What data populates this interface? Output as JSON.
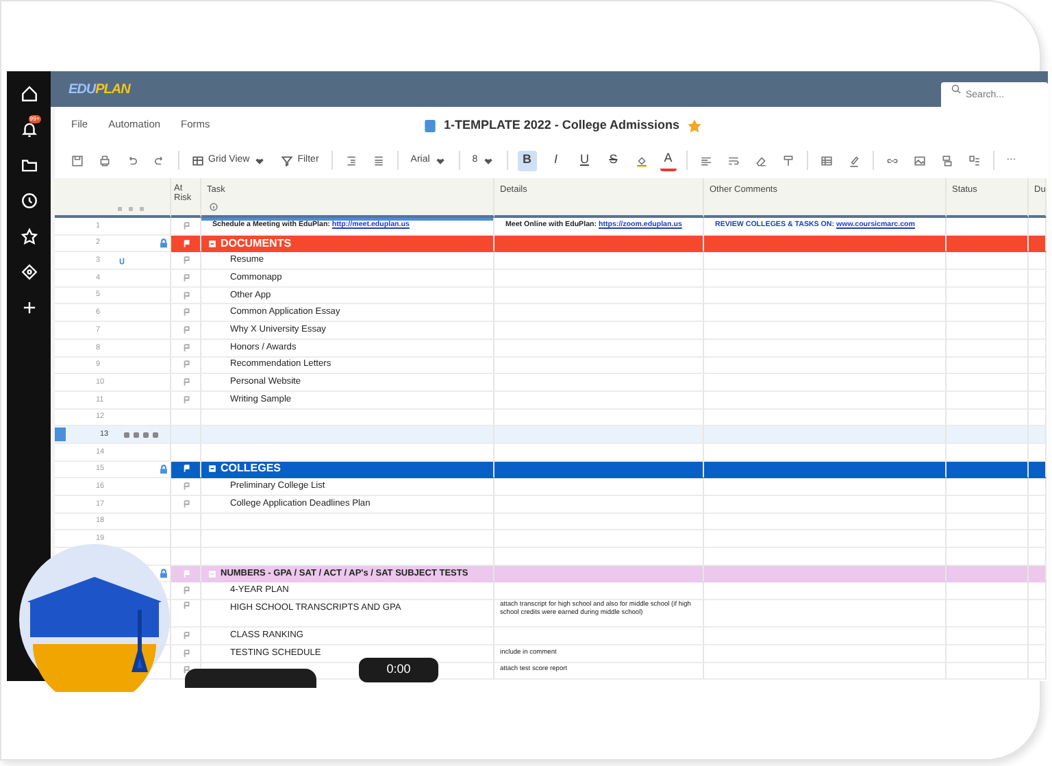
{
  "sidebar": {
    "notification_badge": "99+"
  },
  "header": {
    "logo": [
      "EDU",
      "PLAN"
    ],
    "search": {
      "placeholder": "Search..."
    }
  },
  "menu": [
    "File",
    "Automation",
    "Forms"
  ],
  "sheet_title": {
    "text": "1-TEMPLATE 2022 - College Admissions",
    "favorite": true
  },
  "toolbar": {
    "view": "Grid View",
    "filter": "Filter",
    "font": "Arial",
    "size": "8",
    "format": [
      {
        "label": "B",
        "selected": true
      },
      {
        "label": "I",
        "selected": false
      },
      {
        "label": "U",
        "selected": false
      },
      {
        "label": "S",
        "selected": false
      }
    ],
    "text_color": "A",
    "more": "···"
  },
  "columns": [
    {
      "label": "At Risk"
    },
    {
      "label": "Task"
    },
    {
      "label": "Details"
    },
    {
      "label": "Other Comments"
    },
    {
      "label": "Status"
    },
    {
      "label": "Du"
    }
  ],
  "rows": [
    {
      "num": "1",
      "kind": "note",
      "task": "Schedule a Meeting with EduPlan: ",
      "task_link": "http://meet.eduplan.us",
      "details": "Meet Online with EduPlan: ",
      "details_link": "https://zoom.eduplan.us",
      "comments": "REVIEW COLLEGES & TASKS ON: ",
      "comments_link": "www.coursicmarc.com",
      "selected": false,
      "locked": false,
      "attachment": false
    },
    {
      "num": "2",
      "kind": "section",
      "task": "DOCUMENTS",
      "color": "#f4492d",
      "selected": false,
      "locked": true,
      "attachment": false
    },
    {
      "num": "3",
      "kind": "task",
      "task": "Resume",
      "selected": false,
      "locked": false,
      "attachment": true
    },
    {
      "num": "4",
      "kind": "task",
      "task": "Commonapp",
      "selected": false,
      "locked": false,
      "attachment": false
    },
    {
      "num": "5",
      "kind": "task",
      "task": "Other App",
      "selected": false,
      "locked": false,
      "attachment": false
    },
    {
      "num": "6",
      "kind": "task",
      "task": "Common Application Essay",
      "selected": false,
      "locked": false,
      "attachment": false
    },
    {
      "num": "7",
      "kind": "task",
      "task": "Why X University Essay",
      "selected": false,
      "locked": false,
      "attachment": false
    },
    {
      "num": "8",
      "kind": "task",
      "task": "Honors / Awards",
      "selected": false,
      "locked": false,
      "attachment": false
    },
    {
      "num": "9",
      "kind": "task",
      "task": "Recommendation Letters",
      "selected": false,
      "locked": false,
      "attachment": false
    },
    {
      "num": "10",
      "kind": "task",
      "task": "Personal Website",
      "selected": false,
      "locked": false,
      "attachment": false
    },
    {
      "num": "11",
      "kind": "task",
      "task": "Writing Sample",
      "selected": false,
      "locked": false,
      "attachment": false
    },
    {
      "num": "12",
      "kind": "blank",
      "selected": false,
      "locked": false,
      "attachment": false
    },
    {
      "num": "13",
      "kind": "blank",
      "selected": true,
      "locked": false,
      "attachment": false
    },
    {
      "num": "14",
      "kind": "blank",
      "selected": false,
      "locked": false,
      "attachment": false
    },
    {
      "num": "15",
      "kind": "section",
      "task": "COLLEGES",
      "color": "#0a5fc6",
      "selected": false,
      "locked": true,
      "attachment": false
    },
    {
      "num": "16",
      "kind": "task",
      "task": "Preliminary College List",
      "selected": false,
      "locked": false,
      "attachment": false
    },
    {
      "num": "17",
      "kind": "task",
      "task": "College Application Deadlines Plan",
      "selected": false,
      "locked": false,
      "attachment": false
    },
    {
      "num": "18",
      "kind": "blank",
      "selected": false,
      "locked": false,
      "attachment": false
    },
    {
      "num": "19",
      "kind": "blank",
      "selected": false,
      "locked": false,
      "attachment": false
    },
    {
      "kind": "blank",
      "selected": false
    },
    {
      "kind": "section",
      "task": "NUMBERS - GPA / SAT / ACT / AP's / SAT SUBJECT TESTS",
      "color": "#ebc8ec",
      "selected": false,
      "locked": true
    },
    {
      "kind": "task",
      "task": "4-YEAR PLAN",
      "selected": false,
      "locked": false
    },
    {
      "kind": "task",
      "task": "HIGH SCHOOL TRANSCRIPTS AND GPA",
      "details": "attach transcript for high school and also for middle school (if high school credits were earned during middle school)",
      "selected": false
    },
    {
      "kind": "task",
      "task": "CLASS RANKING",
      "selected": false
    },
    {
      "kind": "task",
      "task": "TESTING SCHEDULE",
      "details": "include in comment",
      "selected": false
    },
    {
      "kind": "task",
      "details": "attach test score report",
      "selected": false
    }
  ],
  "video": {
    "time": "0:00"
  }
}
